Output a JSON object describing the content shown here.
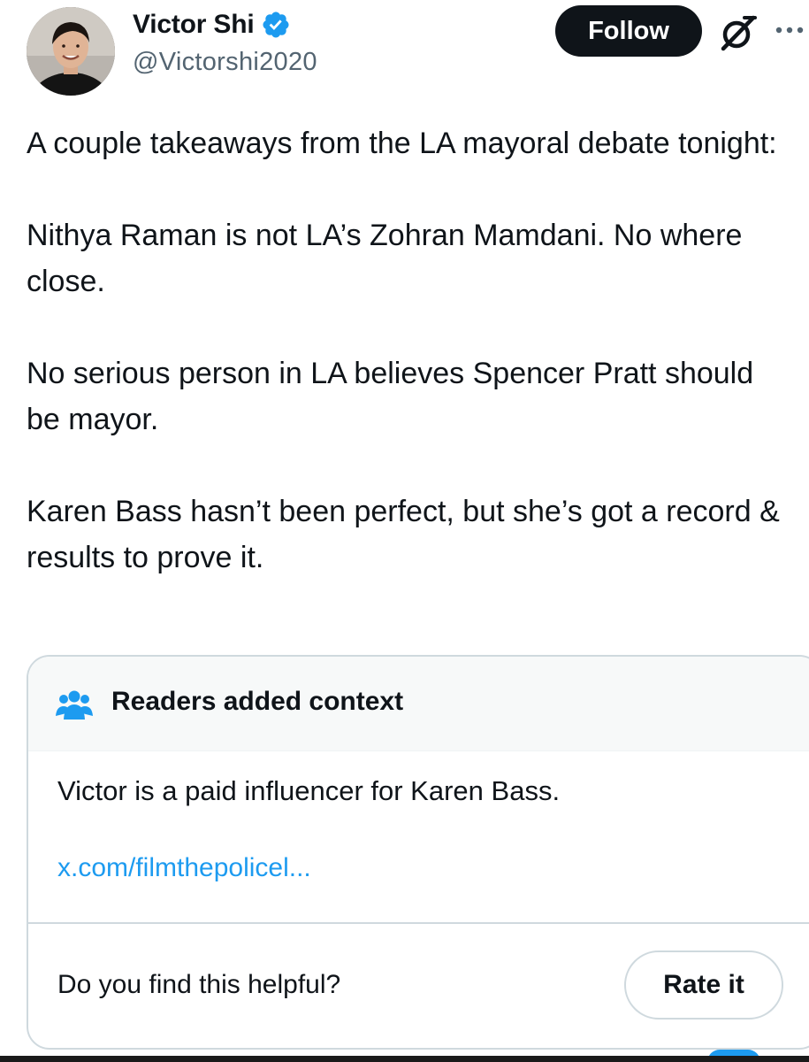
{
  "author": {
    "display_name": "Victor Shi",
    "handle": "@Victorshi2020",
    "verified": true,
    "avatar_icon": "profile-photo"
  },
  "header": {
    "follow_label": "Follow",
    "grok_icon": "grok-icon",
    "more_icon": "more-icon"
  },
  "tweet": {
    "paragraphs": [
      "A couple takeaways from the LA mayoral debate tonight:",
      "Nithya Raman is not LA’s Zohran Mamdani. No where close.",
      "No serious person in LA believes Spencer Pratt should be mayor.",
      "Karen Bass hasn’t been perfect, but she’s got a record & results to prove it."
    ]
  },
  "community_note": {
    "title": "Readers added context",
    "icon": "community-notes-icon",
    "text": "Victor is a paid influencer for Karen Bass.",
    "link_text": "x.com/filmthepolicel...",
    "question": "Do you find this helpful?",
    "rate_label": "Rate it"
  },
  "colors": {
    "accent": "#1d9bf0",
    "text": "#0f1419",
    "muted": "#536471",
    "border": "#cfd9de"
  }
}
